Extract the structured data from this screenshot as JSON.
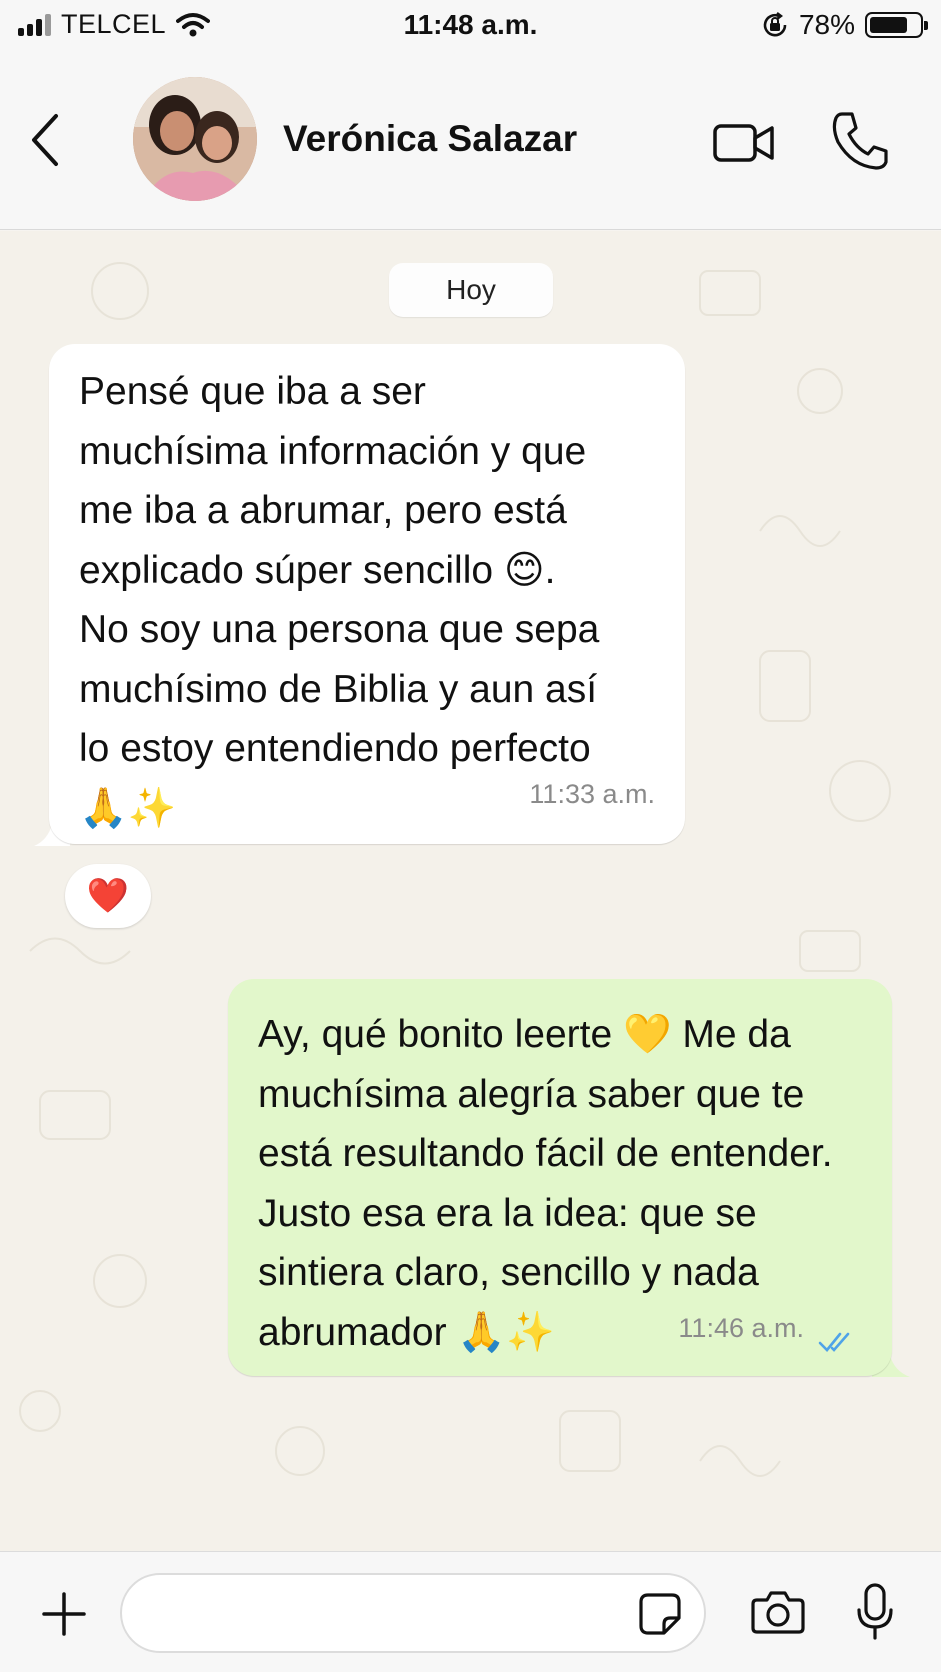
{
  "status_bar": {
    "carrier": "TELCEL",
    "time": "11:48 a.m.",
    "battery_percent": "78%",
    "battery_level": 0.78,
    "icons": [
      "signal-icon",
      "wifi-icon",
      "orientation-lock-icon",
      "battery-icon"
    ]
  },
  "header": {
    "contact_name": "Verónica Salazar",
    "icons": [
      "back-arrow-icon",
      "video-call-icon",
      "phone-call-icon"
    ]
  },
  "chat": {
    "day_label": "Hoy",
    "messages": [
      {
        "direction": "incoming",
        "text": "Pensé que iba a ser\nmuchísima información y que\nme iba a abrumar, pero está\nexplicado súper sencillo 😊.\nNo soy una persona que sepa\nmuchísimo de Biblia y aun así\nlo estoy entendiendo perfecto\n🙏✨",
        "time": "11:33 a.m.",
        "reaction": "❤️"
      },
      {
        "direction": "outgoing",
        "text": "Ay, qué bonito leerte 💛 Me da\nmuchísima alegría saber que te\nestá resultando fácil de entender.\nJusto esa era la idea: que se\nsintiera claro, sencillo y nada\nabrumador 🙏✨",
        "time": "11:46 a.m.",
        "status": "read"
      }
    ]
  },
  "input_bar": {
    "placeholder": "",
    "icons": [
      "plus-icon",
      "sticker-icon",
      "camera-icon",
      "microphone-icon"
    ]
  },
  "colors": {
    "incoming_bubble": "#ffffff",
    "outgoing_bubble": "#e2f7cb",
    "read_check": "#4fa3e8",
    "chat_background": "#f4f1ea"
  }
}
